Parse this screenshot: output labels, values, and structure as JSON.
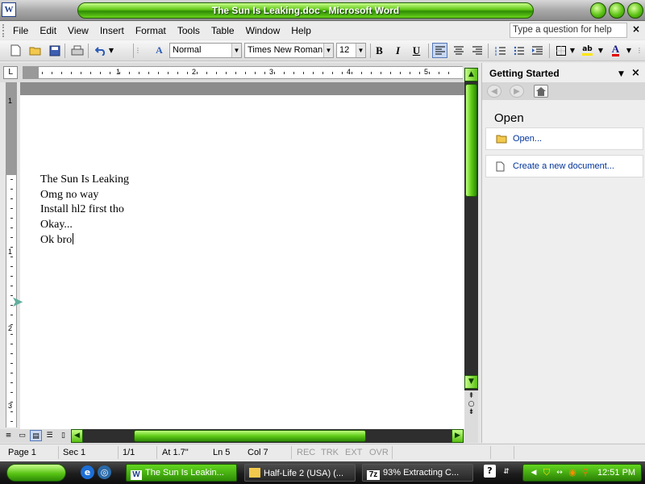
{
  "window": {
    "title": "The Sun Is Leaking.doc - Microsoft Word",
    "app_icon": "W"
  },
  "menu": {
    "items": [
      "File",
      "Edit",
      "View",
      "Insert",
      "Format",
      "Tools",
      "Table",
      "Window",
      "Help"
    ],
    "help_placeholder": "Type a question for help",
    "help_close": "×"
  },
  "toolbar": {
    "style": "Normal",
    "font": "Times New Roman",
    "size": "12",
    "bold": "B",
    "italic": "I",
    "underline": "U",
    "style_icon_text": "A",
    "highlight_text": "ab"
  },
  "ruler": {
    "numbers": [
      "1",
      "2",
      "3",
      "4",
      "5"
    ],
    "vnumbers": [
      "1",
      "1",
      "2",
      "3"
    ],
    "tab_marker": "L"
  },
  "document": {
    "lines": [
      "The Sun Is Leaking",
      "Omg no way",
      "Install hl2 first tho",
      "Okay...",
      "Ok bro"
    ]
  },
  "task_pane": {
    "title": "Getting Started",
    "section": "Open",
    "links": [
      "Open...",
      "Create a new document..."
    ]
  },
  "status": {
    "page": "Page  1",
    "sec": "Sec  1",
    "pages": "1/1",
    "at": "At  1.7\"",
    "ln": "Ln  5",
    "col": "Col  7",
    "rec": "REC",
    "trk": "TRK",
    "ext": "EXT",
    "ovr": "OVR"
  },
  "taskbar": {
    "tasks": [
      "The Sun Is Leakin...",
      "Half-Life 2 (USA) (...",
      "93% Extracting C..."
    ],
    "task_icons": [
      "W",
      "",
      "7z"
    ],
    "clock": "12:51 PM",
    "help_icon": "?"
  },
  "colors": {
    "accent_green": "#5fc514",
    "link_blue": "#003399"
  },
  "icons": [
    "new-doc-icon",
    "open-folder-icon",
    "save-icon",
    "print-icon",
    "undo-icon",
    "styles-icon",
    "bullets-icon",
    "numbering-icon",
    "indent-icon",
    "border-icon",
    "highlight-icon",
    "font-color-icon",
    "home-icon",
    "ie-icon",
    "shield-icon",
    "search-icon"
  ]
}
